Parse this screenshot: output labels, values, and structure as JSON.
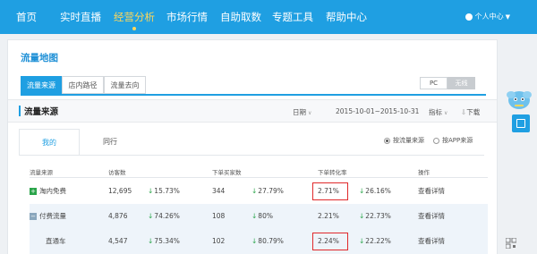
{
  "nav": {
    "items": [
      {
        "label": "首页"
      },
      {
        "label": "实时直播"
      },
      {
        "label": "经营分析"
      },
      {
        "label": "市场行情"
      },
      {
        "label": "自助取数"
      },
      {
        "label": "专题工具"
      },
      {
        "label": "帮助中心"
      }
    ],
    "active_index": 2,
    "user_label": "个人中心"
  },
  "page": {
    "title": "流量地图",
    "tabs": [
      {
        "label": "流量来源"
      },
      {
        "label": "店内路径"
      },
      {
        "label": "流量去向"
      }
    ],
    "device_toggle": [
      {
        "label": "PC"
      },
      {
        "label": "无线"
      }
    ]
  },
  "section": {
    "title": "流量来源",
    "date_label": "日期",
    "date_range": "2015-10-01~2015-10-31",
    "metric_label": "指标",
    "download_label": "下载",
    "inner_tabs": [
      {
        "label": "我的"
      },
      {
        "label": "同行"
      }
    ],
    "radios": [
      {
        "label": "按流量来源"
      },
      {
        "label": "按APP来源"
      }
    ]
  },
  "table": {
    "headers": [
      "流量来源",
      "访客数",
      "下单买家数",
      "下单转化率",
      "操作"
    ],
    "rows": [
      {
        "source": "淘内免费",
        "visitors": "12,695",
        "visitors_change": "15.73%",
        "buyers": "344",
        "buyers_change": "27.79%",
        "conversion": "2.71%",
        "conversion_change": "26.16%",
        "action": "查看详情"
      },
      {
        "source": "付费流量",
        "visitors": "4,876",
        "visitors_change": "74.26%",
        "buyers": "108",
        "buyers_change": "80%",
        "conversion": "2.21%",
        "conversion_change": "22.73%",
        "action": "查看详情"
      },
      {
        "source": "直通车",
        "visitors": "4,547",
        "visitors_change": "75.34%",
        "buyers": "102",
        "buyers_change": "80.79%",
        "conversion": "2.24%",
        "conversion_change": "22.22%",
        "action": "查看详情"
      }
    ]
  },
  "colors": {
    "brand": "#1f9fe2",
    "active_nav": "#ffd75a",
    "decrease_arrow": "#2aa44a",
    "highlight": "#e0292b"
  },
  "icons": {
    "down_arrow": "↓",
    "expand_plus": "+",
    "collapse_minus": "−"
  }
}
